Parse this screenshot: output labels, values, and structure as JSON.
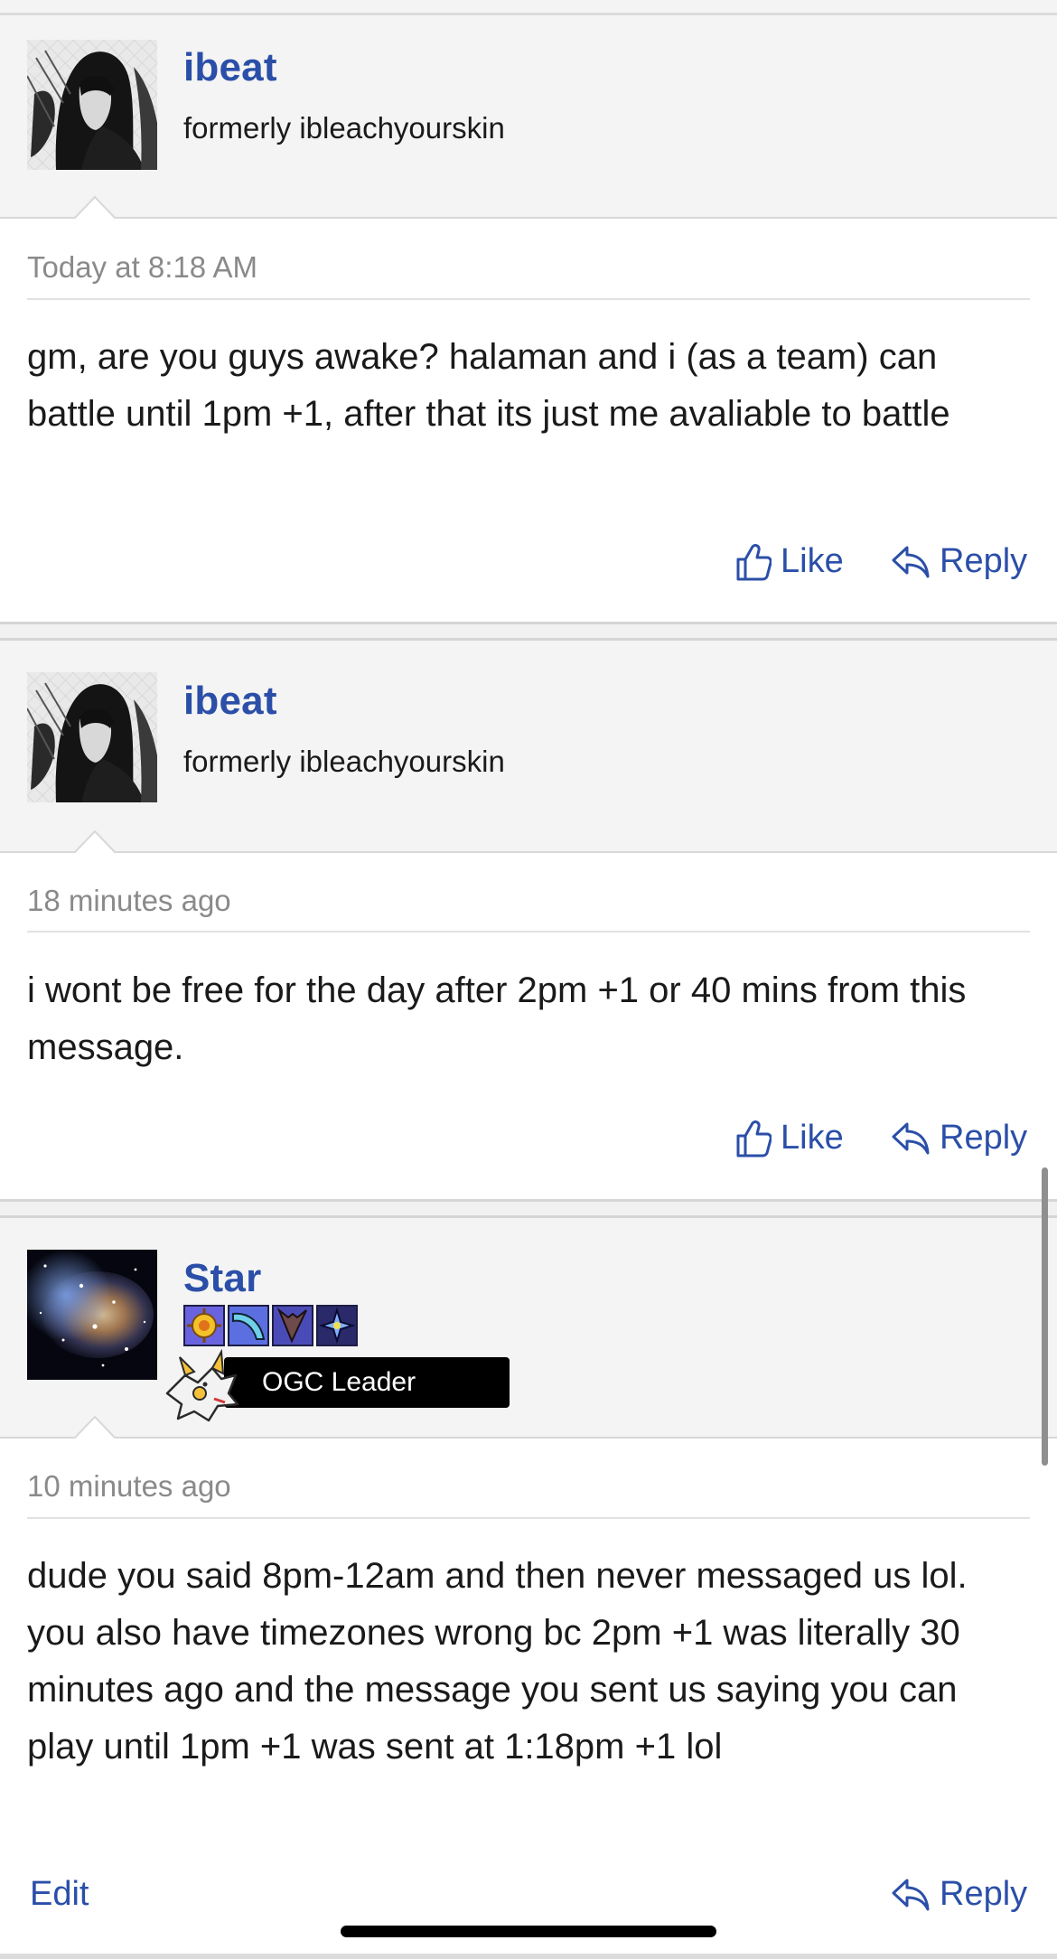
{
  "posts": [
    {
      "username": "ibeat",
      "user_title": "formerly ibleachyourskin",
      "timestamp": "Today at 8:18 AM",
      "message": "gm, are you guys awake? halaman and i (as a team) can battle until 1pm +1, after that its just me avaliable to battle",
      "actions": {
        "like": "Like",
        "reply": "Reply"
      }
    },
    {
      "username": "ibeat",
      "user_title": "formerly ibleachyourskin",
      "timestamp": "18 minutes ago",
      "message": "i wont be free for the day after 2pm +1 or 40 mins from this message.",
      "actions": {
        "like": "Like",
        "reply": "Reply"
      }
    },
    {
      "username": "Star",
      "rank_banner": "OGC Leader",
      "badges": [
        "sun-badge",
        "wave-badge",
        "horn-badge",
        "star-badge"
      ],
      "timestamp": "10 minutes ago",
      "message": "dude you said 8pm-12am and then never messaged us lol. you also have timezones wrong bc 2pm +1 was literally 30 minutes ago and the message you sent us saying you can play until 1pm +1 was sent at 1:18pm +1 lol",
      "actions": {
        "edit": "Edit",
        "reply": "Reply"
      }
    }
  ],
  "colors": {
    "link": "#2b4fa8",
    "header_bg": "#f4f4f4",
    "timestamp": "#8a8a8a",
    "text": "#1a1a1a"
  },
  "icons": {
    "like": "thumbs-up-icon",
    "reply": "reply-arrow-icon"
  }
}
